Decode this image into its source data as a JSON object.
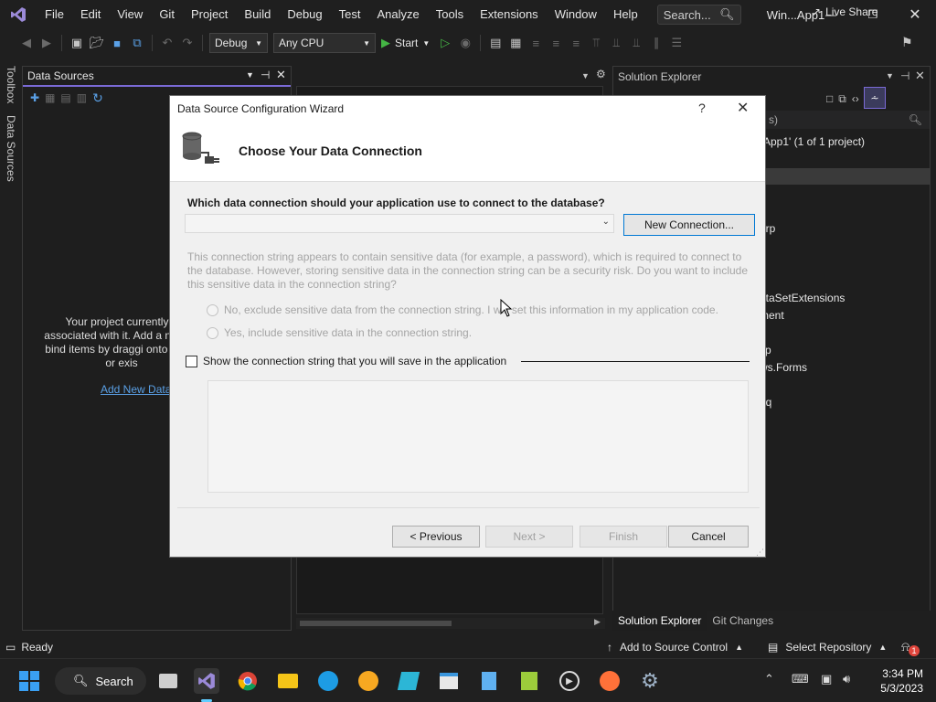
{
  "menubar": {
    "items": [
      "File",
      "Edit",
      "View",
      "Git",
      "Project",
      "Build",
      "Debug",
      "Test",
      "Analyze",
      "Tools",
      "Extensions",
      "Window",
      "Help"
    ],
    "search_placeholder": "Search...",
    "app_title": "Win...App1"
  },
  "toolbar": {
    "config": "Debug",
    "platform": "Any CPU",
    "start_label": "Start",
    "live_share": "Live Share"
  },
  "side_tabs": {
    "toolbox": "Toolbox",
    "data_sources": "Data Sources"
  },
  "data_sources_panel": {
    "title": "Data Sources",
    "message": "Your project currently h associated with it. Add a n data-bind items by draggi onto forms or exis",
    "link": "Add New Data"
  },
  "solution_explorer": {
    "title": "Solution Explorer",
    "search_suffix": "s)",
    "solution_line": "App1' (1 of 1 project)",
    "items": [
      "arp",
      "ataSetExtensions",
      "ment",
      "g",
      "cp",
      "ws.Forms",
      "nq"
    ],
    "tabs": [
      "Solution Explorer",
      "Git Changes"
    ]
  },
  "dialog": {
    "title": "Data Source Configuration Wizard",
    "help": "?",
    "heading": "Choose Your Data Connection",
    "question": "Which data connection should your application use to connect to the database?",
    "connection_value": "",
    "new_connection": "New Connection...",
    "warning": "This connection string appears to contain sensitive data (for example, a password), which is required to connect to the database. However, storing sensitive data in the connection string can be a security risk. Do you want to include this sensitive data in the connection string?",
    "radio_exclude": "No, exclude sensitive data from the connection string. I will set this information in my application code.",
    "radio_include": "Yes, include sensitive data in the connection string.",
    "show_connection_string": "Show the connection string that you will save in the application",
    "connection_string": "",
    "buttons": {
      "previous": "< Previous",
      "next": "Next >",
      "finish": "Finish",
      "cancel": "Cancel"
    }
  },
  "statusbar": {
    "ready": "Ready",
    "source_control": "Add to Source Control",
    "repository": "Select Repository",
    "notifications": "1"
  },
  "taskbar": {
    "search": "Search",
    "time": "3:34 PM",
    "date": "5/3/2023"
  },
  "colors": {
    "accent": "#7a6ad6",
    "link": "#5aa0e6",
    "dialog_bg": "#f0f0f0",
    "ide_bg": "#1f1f1f"
  }
}
